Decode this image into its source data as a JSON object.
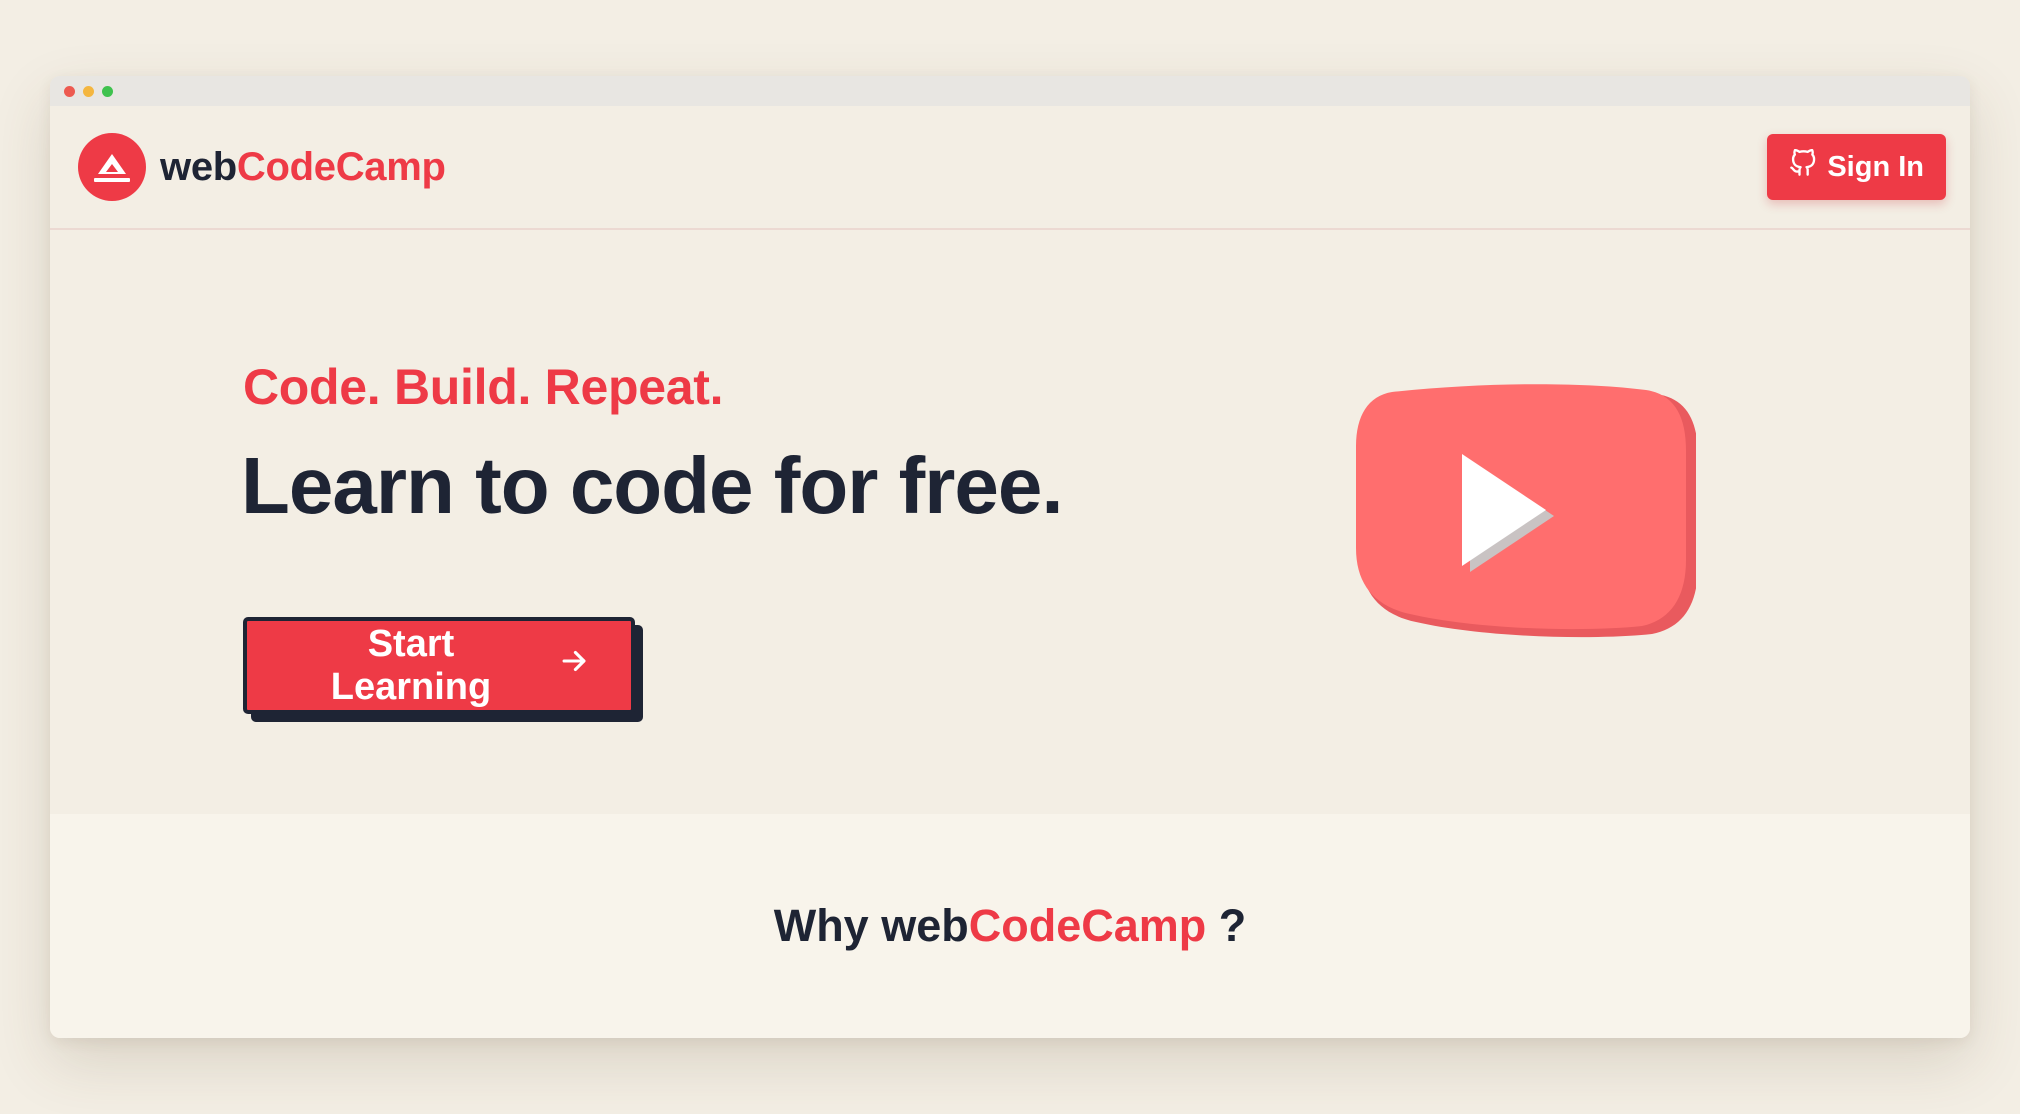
{
  "colors": {
    "brand_red": "#ee3a46",
    "dark_text": "#1e2434",
    "play_red": "#ff6e6e",
    "page_bg": "#f3eee4",
    "section_bg": "#f8f4eb"
  },
  "window": {
    "traffic_lights": [
      "#ed5a50",
      "#f4b63f",
      "#3fc24e"
    ]
  },
  "brand": {
    "prefix": "web",
    "accent": "CodeCamp",
    "logo_icon": "triangle-logo-icon"
  },
  "header": {
    "signin_icon": "github-icon",
    "signin_label": "Sign In"
  },
  "hero": {
    "tagline": "Code. Build. Repeat.",
    "headline": "Learn to code for free.",
    "cta_label": "Start Learning",
    "cta_icon": "arrow-right-icon",
    "illustration": "youtube-play-icon"
  },
  "features": {
    "heading_prefix": "Why web",
    "heading_accent": "CodeCamp",
    "heading_suffix": " ?"
  }
}
